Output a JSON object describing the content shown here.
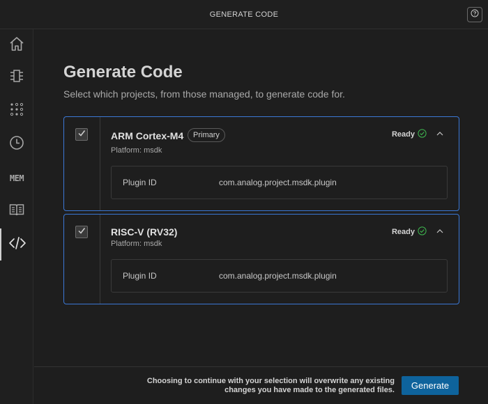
{
  "titlebar": {
    "title": "GENERATE CODE",
    "help_icon": "question-circle-icon"
  },
  "activity_bar": {
    "items": [
      {
        "name": "home",
        "icon": "home-icon"
      },
      {
        "name": "peripherals",
        "icon": "chip-icon"
      },
      {
        "name": "pin-config",
        "icon": "pin-grid-icon"
      },
      {
        "name": "clock",
        "icon": "clock-icon"
      },
      {
        "name": "memory",
        "label": "MEM"
      },
      {
        "name": "docs",
        "icon": "book-icon"
      },
      {
        "name": "generate-code",
        "icon": "code-icon",
        "active": true
      }
    ]
  },
  "page": {
    "title": "Generate Code",
    "subtitle": "Select which projects, from those managed, to generate code for."
  },
  "projects": [
    {
      "name": "ARM Cortex-M4",
      "badge": "Primary",
      "platform": "Platform: msdk",
      "status": "Ready",
      "checked": true,
      "plugin_key": "Plugin ID",
      "plugin_value": "com.analog.project.msdk.plugin"
    },
    {
      "name": "RISC-V (RV32)",
      "badge": "",
      "platform": "Platform: msdk",
      "status": "Ready",
      "checked": true,
      "plugin_key": "Plugin ID",
      "plugin_value": "com.analog.project.msdk.plugin"
    }
  ],
  "footer": {
    "note": "Choosing to continue with your selection will overwrite any existing changes you have made to the generated files.",
    "generate_label": "Generate"
  },
  "colors": {
    "accent": "#0e639c",
    "card_border": "#3b78d6",
    "ready_green": "#3fb950"
  }
}
